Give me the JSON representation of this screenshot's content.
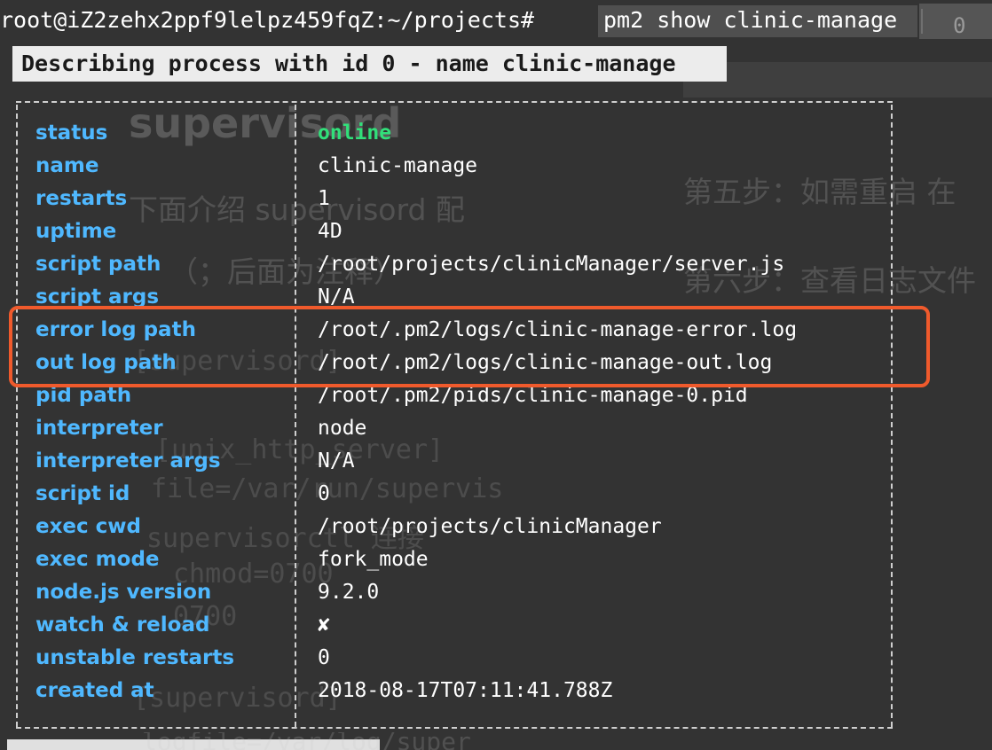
{
  "terminal": {
    "prompt": "root@iZ2zehx2ppf9lelpz459fqZ:~/projects#",
    "command": "pm2 show clinic-manage",
    "tab_number": "0",
    "describe_line": "Describing process with id 0 - name clinic-manage",
    "highlight_color": "#f05a2c",
    "rows": [
      {
        "key": "status",
        "value": "online"
      },
      {
        "key": "name",
        "value": "clinic-manage"
      },
      {
        "key": "restarts",
        "value": "1"
      },
      {
        "key": "uptime",
        "value": "4D"
      },
      {
        "key": "script path",
        "value": "/root/projects/clinicManager/server.js"
      },
      {
        "key": "script args",
        "value": "N/A"
      },
      {
        "key": "error log path",
        "value": "/root/.pm2/logs/clinic-manage-error.log"
      },
      {
        "key": "out log path",
        "value": "/root/.pm2/logs/clinic-manage-out.log"
      },
      {
        "key": "pid path",
        "value": "/root/.pm2/pids/clinic-manage-0.pid"
      },
      {
        "key": "interpreter",
        "value": "node"
      },
      {
        "key": "interpreter args",
        "value": "N/A"
      },
      {
        "key": "script id",
        "value": "0"
      },
      {
        "key": "exec cwd",
        "value": "/root/projects/clinicManager"
      },
      {
        "key": "exec mode",
        "value": "fork_mode"
      },
      {
        "key": "node.js version",
        "value": "9.2.0"
      },
      {
        "key": "watch & reload",
        "value": "✘"
      },
      {
        "key": "unstable restarts",
        "value": "0"
      },
      {
        "key": "created at",
        "value": "2018-08-17T07:11:41.788Z"
      }
    ]
  },
  "background": {
    "heading": "supervisord",
    "cn_intro": "下面介绍 supervisord 配",
    "cn_note": "（；后面为注释）",
    "cn_step5": "第五步：如需重启 在",
    "cn_step6": "第六步：查看日志文件",
    "code_lines": [
      "[supervisord]",
      "[unix_http_server]",
      "file=/var/run/supervis",
      "supervisorctl 连接",
      "chmod=0700",
      "0700",
      "[supervisord]",
      "logfile=/var/log/super"
    ]
  }
}
